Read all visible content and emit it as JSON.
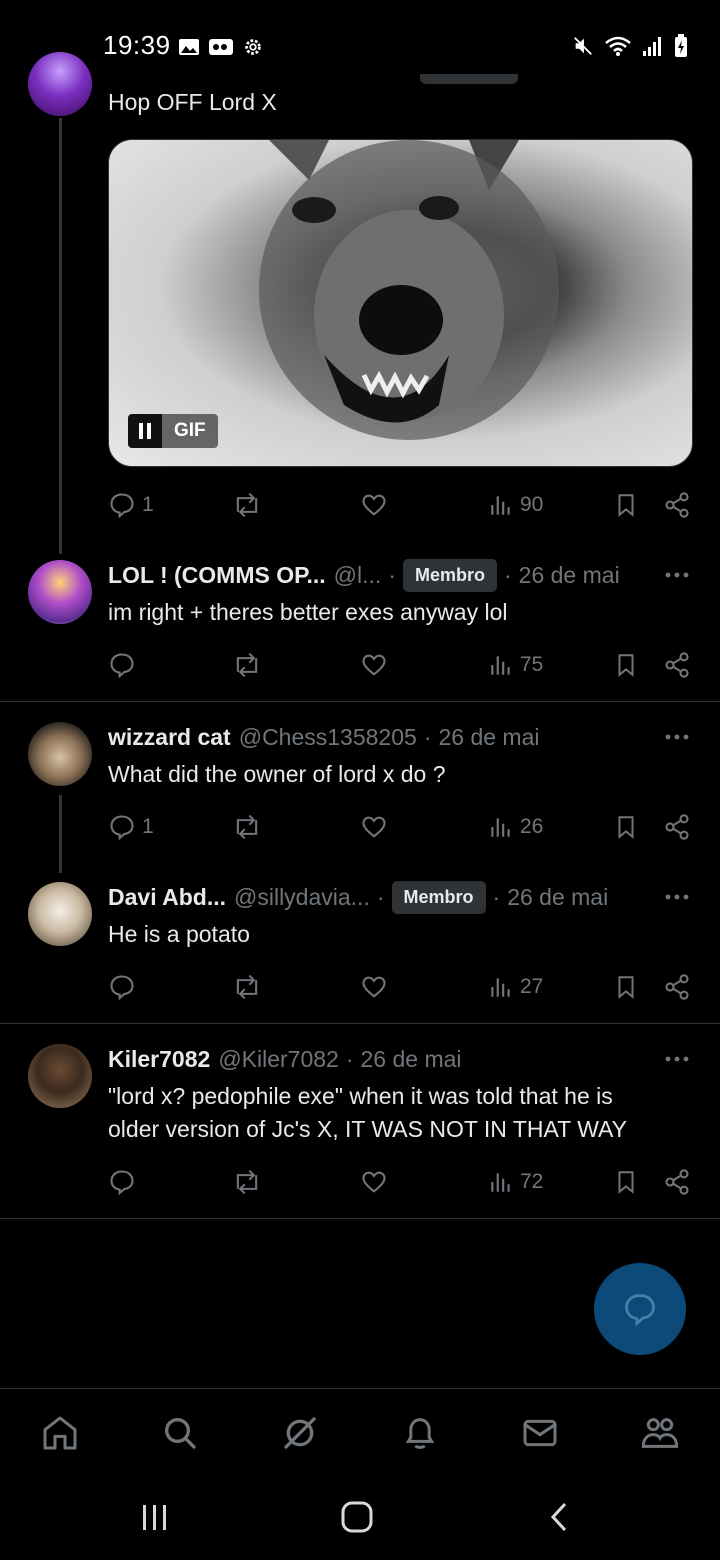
{
  "status_bar": {
    "time": "19:39",
    "left_icons": [
      "image-icon",
      "voicemail-icon",
      "settings-gear-icon"
    ],
    "right_icons": [
      "mute-icon",
      "wifi-icon",
      "signal-icon",
      "battery-charging-icon"
    ]
  },
  "top_tweet": {
    "text": "Hop OFF Lord X",
    "media_badge": "GIF",
    "actions": {
      "replies": "1",
      "reposts": "",
      "likes": "",
      "views": "90"
    }
  },
  "replies": [
    {
      "display_name": "LOL ! (COMMS OP...",
      "handle": "@l...",
      "badge": "Membro",
      "date": "26 de mai",
      "text": "im right + theres better exes anyway lol",
      "views": "75"
    },
    {
      "display_name": "wizzard cat",
      "handle": "@Chess1358205",
      "date": "26 de mai",
      "text": "What did the owner of lord x do ?",
      "replies": "1",
      "views": "26"
    },
    {
      "display_name": "Davi Abd...",
      "handle": "@sillydavia...",
      "badge": "Membro",
      "date": "26 de mai",
      "text": "He is a potato",
      "views": "27"
    },
    {
      "display_name": "Kiler7082",
      "handle": "@Kiler7082",
      "date": "26 de mai",
      "text_line1": "\"lord x? pedophile exe\" when it was told that he is",
      "text_line2": "older version of Jc's X, IT WAS NOT IN THAT WAY",
      "views": "72"
    }
  ],
  "separator": "·",
  "nav": [
    "home-icon",
    "search-icon",
    "grok-icon",
    "notifications-icon",
    "messages-icon",
    "communities-icon"
  ],
  "colors": {
    "background": "#000000",
    "text": "#e7e9ea",
    "muted": "#71767b",
    "fab": "#0c4a7a"
  }
}
